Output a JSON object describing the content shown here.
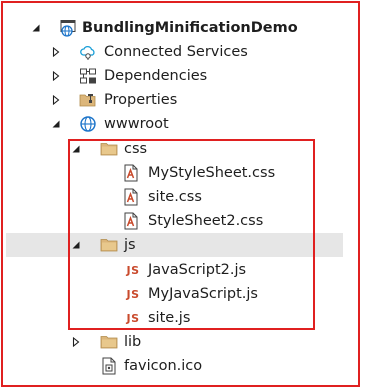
{
  "tree": {
    "project": {
      "label": "BundlingMinificationDemo",
      "icon": "web-project-icon",
      "expanded": true
    },
    "connected_services": {
      "label": "Connected Services",
      "icon": "cloud-services-icon",
      "expanded": false
    },
    "dependencies": {
      "label": "Dependencies",
      "icon": "dependencies-icon",
      "expanded": false
    },
    "properties": {
      "label": "Properties",
      "icon": "properties-folder-icon",
      "expanded": false
    },
    "wwwroot": {
      "label": "wwwroot",
      "icon": "globe-icon",
      "expanded": true
    },
    "css_folder": {
      "label": "css",
      "icon": "folder-icon",
      "expanded": true,
      "files": [
        {
          "label": "MyStyleSheet.css",
          "icon": "css-file-icon"
        },
        {
          "label": "site.css",
          "icon": "css-file-icon"
        },
        {
          "label": "StyleSheet2.css",
          "icon": "css-file-icon"
        }
      ]
    },
    "js_folder": {
      "label": "js",
      "icon": "folder-icon",
      "expanded": true,
      "selected": true,
      "files": [
        {
          "label": "JavaScript2.js",
          "icon": "js-file-icon",
          "badge": "JS"
        },
        {
          "label": "MyJavaScript.js",
          "icon": "js-file-icon",
          "badge": "JS"
        },
        {
          "label": "site.js",
          "icon": "js-file-icon",
          "badge": "JS"
        }
      ]
    },
    "lib_folder": {
      "label": "lib",
      "icon": "folder-icon",
      "expanded": false
    },
    "favicon": {
      "label": "favicon.ico",
      "icon": "icon-file-icon"
    }
  },
  "colors": {
    "highlight_border": "#e02020",
    "selection_background": "#e6e6e6",
    "folder": "#dcb67a",
    "js_badge": "#c94a2c"
  }
}
